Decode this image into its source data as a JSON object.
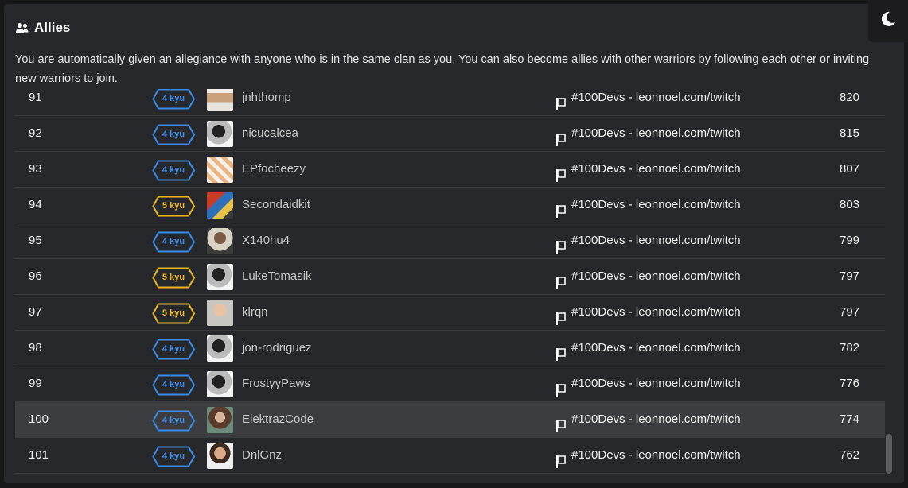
{
  "section": {
    "title": "Allies",
    "title_icon": "users-icon",
    "description": "You are automatically given an allegiance with anyone who is in the same clan as you. You can also become allies with other warriors by following each other or inviting new warriors to join."
  },
  "theme_toggle": {
    "icon": "moon-icon"
  },
  "colors": {
    "blue_rank": "#3b8de7",
    "yellow_rank": "#ecb622",
    "panel_bg": "#27282b",
    "highlight_row": "#3c3d40"
  },
  "rows": [
    {
      "position": "91",
      "rank": "4 kyu",
      "rank_color": "blue",
      "username": "jnhthomp",
      "clan": "#100Devs - leonnoel.com/twitch",
      "honor": "820"
    },
    {
      "position": "92",
      "rank": "4 kyu",
      "rank_color": "blue",
      "username": "nicucalcea",
      "clan": "#100Devs - leonnoel.com/twitch",
      "honor": "815"
    },
    {
      "position": "93",
      "rank": "4 kyu",
      "rank_color": "blue",
      "username": "EPfocheezy",
      "clan": "#100Devs - leonnoel.com/twitch",
      "honor": "807"
    },
    {
      "position": "94",
      "rank": "5 kyu",
      "rank_color": "yellow",
      "username": "Secondaidkit",
      "clan": "#100Devs - leonnoel.com/twitch",
      "honor": "803"
    },
    {
      "position": "95",
      "rank": "4 kyu",
      "rank_color": "blue",
      "username": "X140hu4",
      "clan": "#100Devs - leonnoel.com/twitch",
      "honor": "799"
    },
    {
      "position": "96",
      "rank": "5 kyu",
      "rank_color": "yellow",
      "username": "LukeTomasik",
      "clan": "#100Devs - leonnoel.com/twitch",
      "honor": "797"
    },
    {
      "position": "97",
      "rank": "5 kyu",
      "rank_color": "yellow",
      "username": "klrqn",
      "clan": "#100Devs - leonnoel.com/twitch",
      "honor": "797"
    },
    {
      "position": "98",
      "rank": "4 kyu",
      "rank_color": "blue",
      "username": "jon-rodriguez",
      "clan": "#100Devs - leonnoel.com/twitch",
      "honor": "782"
    },
    {
      "position": "99",
      "rank": "4 kyu",
      "rank_color": "blue",
      "username": "FrostyyPaws",
      "clan": "#100Devs - leonnoel.com/twitch",
      "honor": "776"
    },
    {
      "position": "100",
      "rank": "4 kyu",
      "rank_color": "blue",
      "username": "ElektrazCode",
      "clan": "#100Devs - leonnoel.com/twitch",
      "honor": "774",
      "highlighted": true
    },
    {
      "position": "101",
      "rank": "4 kyu",
      "rank_color": "blue",
      "username": "DnlGnz",
      "clan": "#100Devs - leonnoel.com/twitch",
      "honor": "762"
    }
  ]
}
